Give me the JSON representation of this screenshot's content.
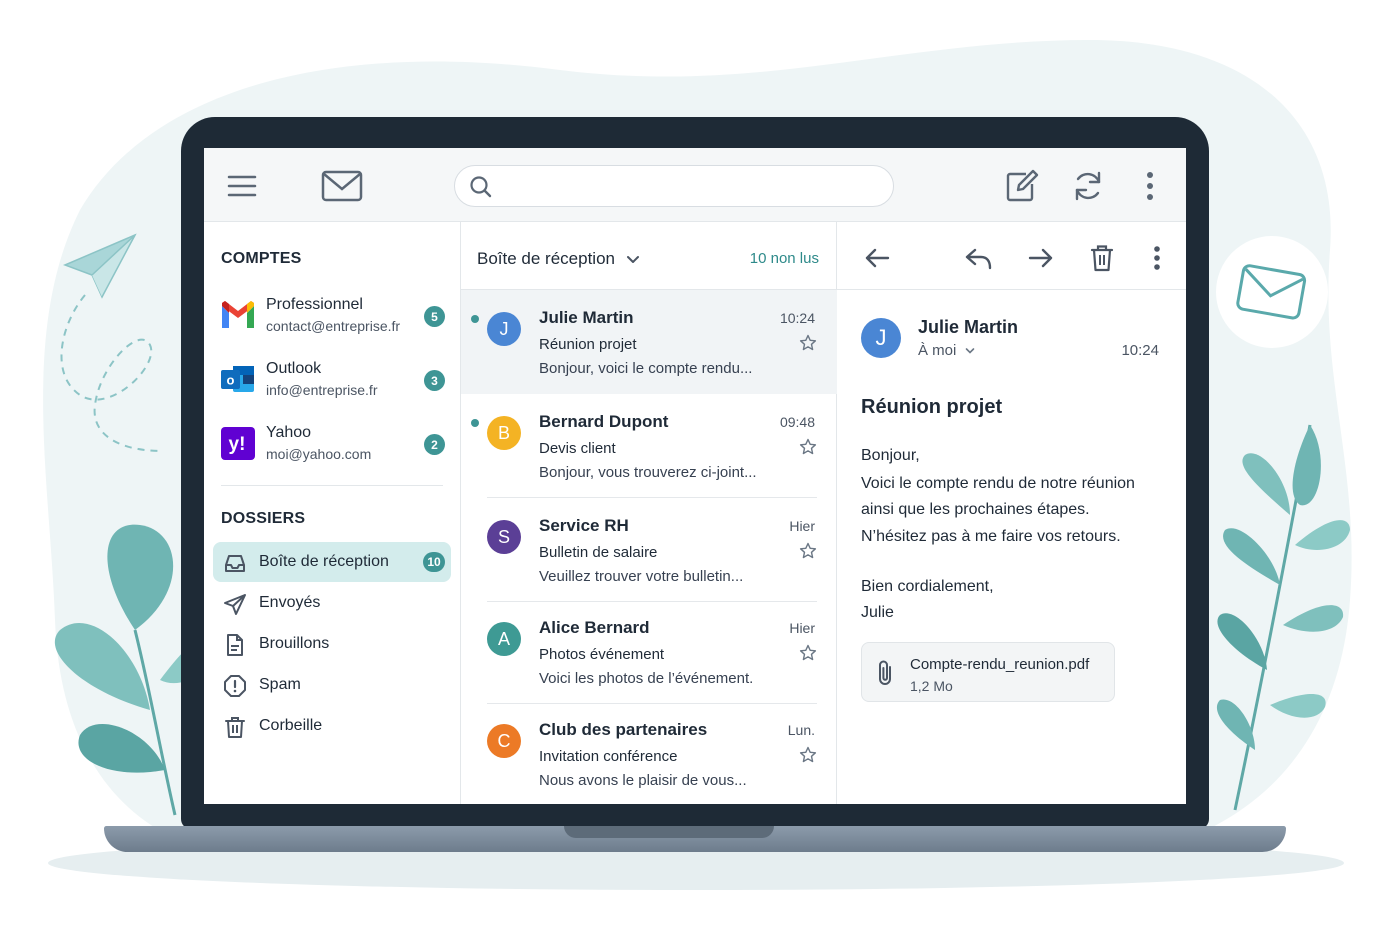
{
  "colors": {
    "accent": "#3e9595",
    "accent_light": "#d3ecec",
    "laptop_frame": "#1e2a36",
    "background_blob": "#eef5f6",
    "leaf": "#6fb5b3"
  },
  "toolbar": {
    "menu_icon": "hamburger-icon",
    "app_icon": "envelope-icon",
    "search_placeholder": "",
    "compose_icon": "compose-icon",
    "refresh_icon": "refresh-icon",
    "more_icon": "more-vertical-icon"
  },
  "sidebar": {
    "accounts_title": "COMPTES",
    "accounts": [
      {
        "name": "Professionnel",
        "email": "contact@entreprise.fr",
        "count": "5",
        "logo": "gmail-logo"
      },
      {
        "name": "Outlook",
        "email": "info@entreprise.fr",
        "count": "3",
        "logo": "outlook-logo"
      },
      {
        "name": "Yahoo",
        "email": "moi@yahoo.com",
        "count": "2",
        "logo": "yahoo-logo"
      }
    ],
    "folders_title": "DOSSIERS",
    "folders": [
      {
        "label": "Boîte de réception",
        "count": "10",
        "icon": "inbox-icon",
        "active": true
      },
      {
        "label": "Envoyés",
        "icon": "send-icon"
      },
      {
        "label": "Brouillons",
        "icon": "draft-icon"
      },
      {
        "label": "Spam",
        "icon": "spam-icon"
      },
      {
        "label": "Corbeille",
        "icon": "trash-icon"
      }
    ]
  },
  "list": {
    "title": "Boîte de réception",
    "unread": "10 non lus",
    "messages": [
      {
        "sender": "Julie Martin",
        "initial": "J",
        "color": "#4a86d4",
        "time": "10:24",
        "subject": "Réunion projet",
        "preview": "Bonjour, voici le compte rendu...",
        "unread": true,
        "selected": true
      },
      {
        "sender": "Bernard Dupont",
        "initial": "B",
        "color": "#f4b324",
        "time": "09:48",
        "subject": "Devis client",
        "preview": "Bonjour, vous trouverez ci-joint...",
        "unread": true
      },
      {
        "sender": "Service RH",
        "initial": "S",
        "color": "#5b3f96",
        "time": "Hier",
        "subject": "Bulletin de salaire",
        "preview": "Veuillez trouver votre bulletin..."
      },
      {
        "sender": "Alice Bernard",
        "initial": "A",
        "color": "#3e9a94",
        "time": "Hier",
        "subject": "Photos événement",
        "preview": "Voici les photos de l’événement."
      },
      {
        "sender": "Club des partenaires",
        "initial": "C",
        "color": "#ec7a26",
        "time": "Lun.",
        "subject": "Invitation conférence",
        "preview": "Nous avons le plaisir de vous..."
      }
    ]
  },
  "reader": {
    "toolbar_icons": [
      "back-arrow-icon",
      "reply-icon",
      "forward-icon",
      "trash-icon",
      "more-vertical-icon"
    ],
    "sender": "Julie Martin",
    "initial": "J",
    "to": "À moi",
    "time": "10:24",
    "subject": "Réunion projet",
    "body": [
      "Bonjour,",
      "Voici le compte rendu de notre réunion",
      "ainsi que les prochaines étapes.",
      "N’hésitez pas à me faire vos retours.",
      "Bien cordialement,",
      "Julie"
    ],
    "attachment": {
      "name": "Compte-rendu_reunion.pdf",
      "size": "1,2 Mo"
    }
  }
}
